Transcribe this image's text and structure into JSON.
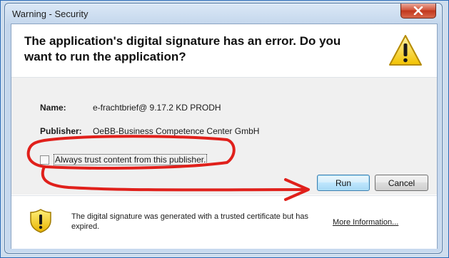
{
  "window": {
    "title": "Warning - Security"
  },
  "header": {
    "headline": "The application's digital signature has an error.  Do you want to run the application?"
  },
  "details": {
    "name_label": "Name:",
    "name_value": "e-frachtbrief@ 9.17.2 KD PRODH",
    "publisher_label": "Publisher:",
    "publisher_value": "OeBB-Business Competence Center GmbH"
  },
  "trust": {
    "checkbox_label": "Always trust content from this publisher.",
    "checked": false
  },
  "buttons": {
    "run": "Run",
    "cancel": "Cancel"
  },
  "footer": {
    "message": "The digital signature was generated with a trusted certificate but has expired.",
    "more_info": "More Information..."
  },
  "colors": {
    "annotation": "#e0201b",
    "accent": "#2a6bb8"
  }
}
